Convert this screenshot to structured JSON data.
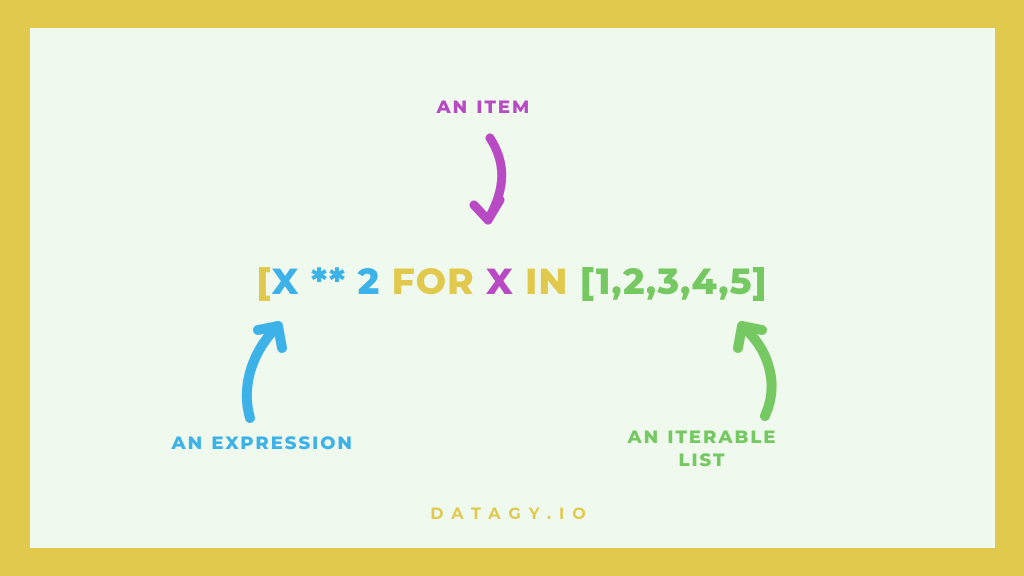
{
  "labels": {
    "item": "AN ITEM",
    "expression": "AN EXPRESSION",
    "iterable": "AN ITERABLE LIST"
  },
  "code": {
    "bracket_open": "[",
    "expr_var": "X ",
    "expr_op": "** ",
    "expr_val": "2 ",
    "for": "FOR ",
    "item": "X ",
    "in": "IN ",
    "iterable": "[1,2,3,4,5]"
  },
  "footer": "DATAGY.IO",
  "colors": {
    "blue": "#3cb2e8",
    "yellow": "#e1c94e",
    "purple": "#b84bc4",
    "green": "#76c862"
  }
}
